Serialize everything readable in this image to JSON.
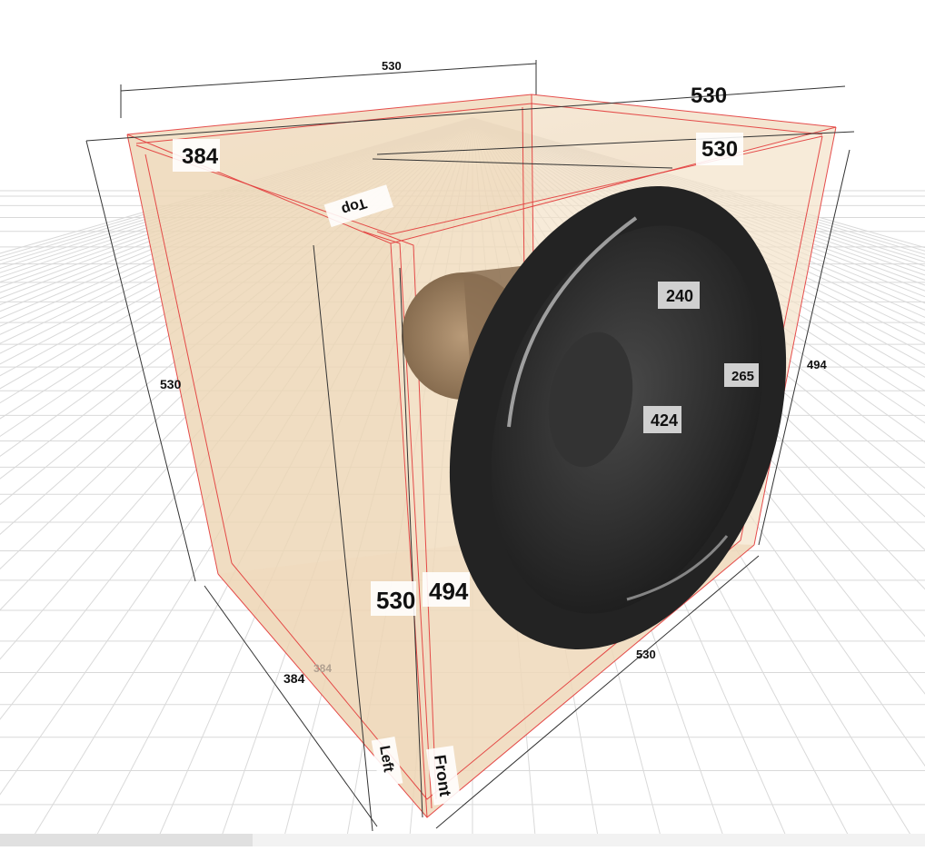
{
  "dimensions": {
    "top_back_width": "530",
    "top_right_width": "530",
    "front_top_width": "530",
    "top_left_depth": "384",
    "left_height": "530",
    "right_height": "494",
    "front_height": "530",
    "inner_front_height": "494",
    "bottom_depth": "384",
    "bottom_depth_ghost": "384",
    "bottom_width": "530"
  },
  "driver": {
    "label_a": "240",
    "label_b": "265",
    "label_c": "424"
  },
  "panel_labels": {
    "top": "Top",
    "left": "Left",
    "front": "Front"
  },
  "colors": {
    "wood": "#f1dcc0",
    "wood_dark": "#e6c9a3",
    "edge": "#e23a3a",
    "driver": "#2a2a2a",
    "grid": "#d9d9d9"
  }
}
